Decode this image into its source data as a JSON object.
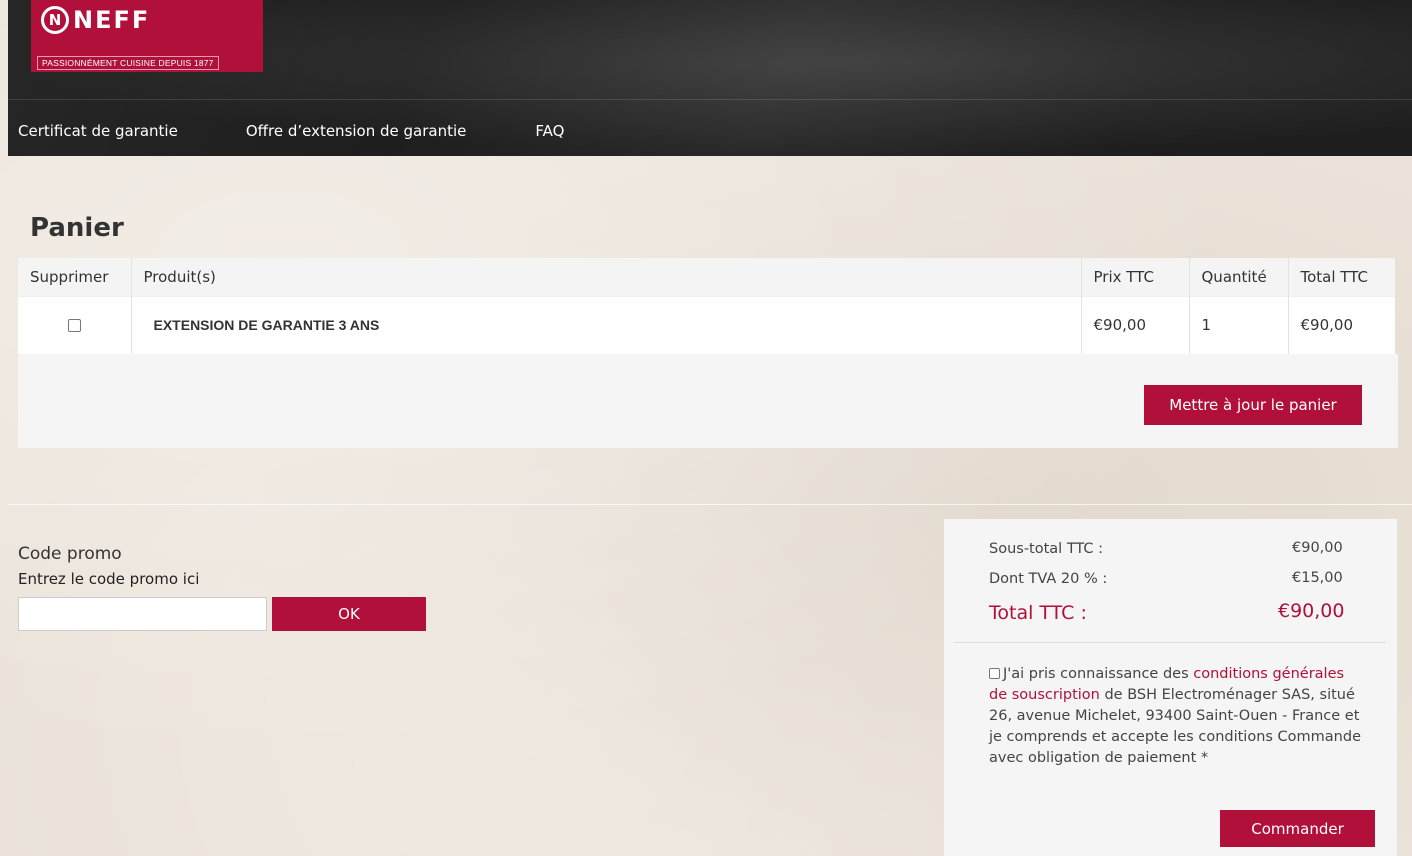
{
  "header": {
    "brand": "NEFF",
    "brand_mark": "N",
    "tagline": "PASSIONNÉMENT CUISINE DEPUIS 1877",
    "nav": [
      {
        "label": "Certificat de garantie"
      },
      {
        "label": "Offre d’extension de garantie"
      },
      {
        "label": "FAQ"
      }
    ]
  },
  "cart": {
    "title": "Panier",
    "columns": {
      "delete": "Supprimer",
      "product": "Produit(s)",
      "price": "Prix TTC",
      "quantity": "Quantité",
      "total": "Total TTC"
    },
    "rows": [
      {
        "product": "EXTENSION DE GARANTIE 3 ANS",
        "price": "€90,00",
        "quantity": "1",
        "total": "€90,00"
      }
    ],
    "update_button": "Mettre à jour le panier"
  },
  "promo": {
    "title": "Code promo",
    "subtitle": "Entrez le code promo ici",
    "input_value": "",
    "button": "OK"
  },
  "summary": {
    "subtotal_label": "Sous-total TTC :",
    "subtotal_value": "€90,00",
    "vat_label": "Dont TVA 20 % :",
    "vat_value": "€15,00",
    "total_label": "Total TTC :",
    "total_value": "€90,00",
    "terms_prefix": "J'ai pris connaissance des ",
    "terms_link": "conditions générales de souscription",
    "terms_suffix": " de BSH Electroménager SAS, situé 26, avenue Michelet, 93400 Saint-Ouen - France et je comprends et accepte les conditions Commande avec obligation de paiement *",
    "order_button": "Commander"
  },
  "colors": {
    "brand_red": "#b0103a",
    "header_dark": "#2a2a2a",
    "page_bg": "#ebe3d9"
  }
}
